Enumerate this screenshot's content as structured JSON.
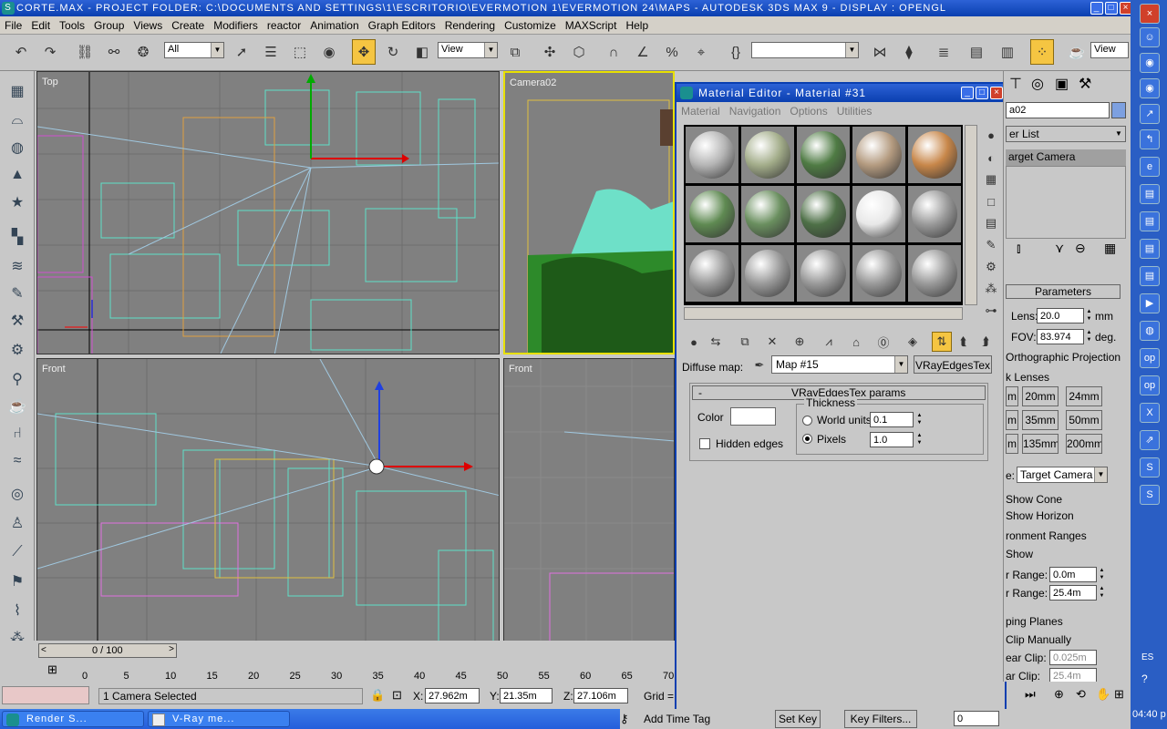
{
  "window": {
    "title": "corte.max    - Project Folder: C:\\Documents and Settings\\1\\Escritorio\\evermotion 1\\evermotion 24\\maps    - Autodesk 3ds Max 9    - Display : OpenGL"
  },
  "menu": [
    "File",
    "Edit",
    "Tools",
    "Group",
    "Views",
    "Create",
    "Modifiers",
    "reactor",
    "Animation",
    "Graph Editors",
    "Rendering",
    "Customize",
    "MAXScript",
    "Help"
  ],
  "toolbar": {
    "selection_filter": "All",
    "ref_coord": "View",
    "named_sel": "",
    "view_right": "View"
  },
  "viewports": {
    "top": "Top",
    "camera": "Camera02",
    "front": "Front",
    "front2": "Front"
  },
  "timeslider": {
    "label": "0 / 100"
  },
  "ruler_ticks": [
    "0",
    "5",
    "10",
    "15",
    "20",
    "25",
    "30",
    "35",
    "40",
    "45",
    "50",
    "55",
    "60",
    "65",
    "70"
  ],
  "status": {
    "selected": "1 Camera Selected",
    "x_label": "X:",
    "x": "27.962m",
    "y_label": "Y:",
    "y": "21.35m",
    "z_label": "Z:",
    "z": "27.106m",
    "grid": "Grid =",
    "add_time_tag": "Add Time Tag",
    "set_key": "Set Key",
    "key_filters": "Key Filters...",
    "frame": "0"
  },
  "taskbar": {
    "task1": "Render S...",
    "task2": "V-Ray me...",
    "lang": "ES",
    "clock": "04:40 p"
  },
  "material_editor": {
    "title": "Material Editor - Material #31",
    "menu": [
      "Material",
      "Navigation",
      "Options",
      "Utilities"
    ],
    "sphere_colors": [
      [
        "#b5b5b5",
        "#a3ad8a",
        "#4f7b44",
        "#b49b80",
        "#c8874a"
      ],
      [
        "#5f8a52",
        "#6a8f5f",
        "#4e7047",
        "#e8e8e8",
        "#9a9a9a"
      ],
      [
        "#9a9a9a",
        "#9a9a9a",
        "#9a9a9a",
        "#9a9a9a",
        "#9a9a9a"
      ]
    ],
    "diffuse_label": "Diffuse map:",
    "map_name": "Map #15",
    "map_type": "VRayEdgesTex",
    "rollout_minus": "-",
    "rollout_title": "VRayEdgesTex params",
    "color_label": "Color",
    "thickness_label": "Thickness",
    "world_units_label": "World units",
    "world_units_value": "0.1",
    "pixels_label": "Pixels",
    "pixels_value": "1.0",
    "hidden_edges_label": "Hidden edges"
  },
  "command_panel": {
    "object_name": "a02",
    "modifier_list": "er List",
    "stack_item": "arget Camera",
    "params_title": "Parameters",
    "lens_label": "Lens:",
    "lens": "20.0",
    "lens_unit": "mm",
    "fov_label": "FOV:",
    "fov": "83.974",
    "fov_unit": "deg.",
    "ortho": "Orthographic Projection",
    "stock_lenses": "k Lenses",
    "lens_btns": [
      "m",
      "20mm",
      "24mm",
      "m",
      "35mm",
      "50mm",
      "m",
      "135mm",
      "200mm"
    ],
    "type_label": "e:",
    "type": "Target Camera",
    "show_cone": "Show Cone",
    "show_horizon": "Show Horizon",
    "env_ranges": "ronment Ranges",
    "show": "Show",
    "near_range_label": "r Range:",
    "near_range": "0.0m",
    "far_range_label": "r Range:",
    "far_range": "25.4m",
    "clip_planes": "ping Planes",
    "clip_manually": "Clip Manually",
    "near_clip_label": "ear Clip:",
    "near_clip": "0.025m",
    "far_clip_label": "ar Clip:",
    "far_clip": "25.4m"
  }
}
